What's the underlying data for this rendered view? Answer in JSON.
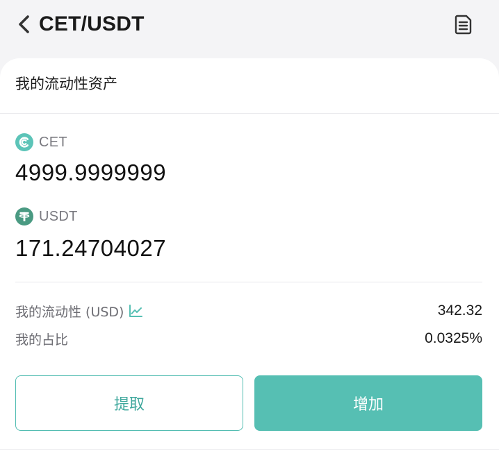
{
  "header": {
    "title": "CET/USDT",
    "back_icon": "chevron-left-icon",
    "record_icon": "document-icon"
  },
  "card": {
    "section_title": "我的流动性资产",
    "assets": [
      {
        "coin": "CET",
        "icon": "cet-coin-icon",
        "amount": "4999.9999999"
      },
      {
        "coin": "USDT",
        "icon": "usdt-coin-icon",
        "amount": "171.24704027"
      }
    ],
    "liquidity_label": "我的流动性 (USD)",
    "liquidity_value": "342.32",
    "share_label": "我的占比",
    "share_value": "0.0325%"
  },
  "actions": {
    "withdraw_label": "提取",
    "add_label": "增加"
  },
  "colors": {
    "accent": "#56bfb3",
    "accent_text": "#40a89d",
    "usdt_green": "#4a9a82"
  }
}
